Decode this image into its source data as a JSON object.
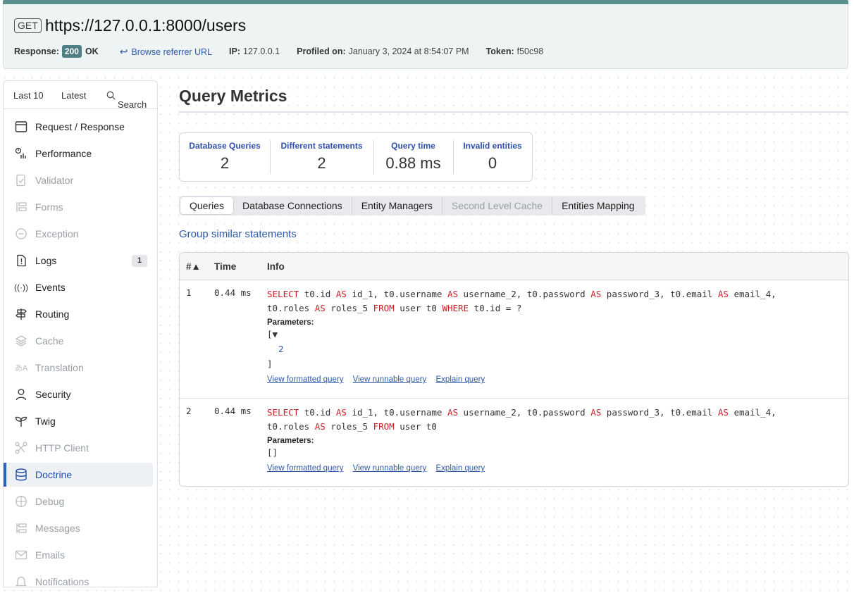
{
  "header": {
    "method": "GET",
    "url": "https://127.0.0.1:8000/users",
    "response_label": "Response:",
    "status_code": "200",
    "status_text": "OK",
    "referrer_link": "Browse referrer URL",
    "ip_label": "IP:",
    "ip_value": "127.0.0.1",
    "profiled_label": "Profiled on:",
    "profiled_value": "January 3, 2024 at 8:54:07 PM",
    "token_label": "Token:",
    "token_value": "f50c98"
  },
  "sidebar": {
    "tabs": [
      "Last 10",
      "Latest",
      "Search"
    ],
    "items": [
      {
        "label": "Request / Response",
        "icon": "request-response-icon",
        "state": "enabled"
      },
      {
        "label": "Performance",
        "icon": "performance-icon",
        "state": "enabled"
      },
      {
        "label": "Validator",
        "icon": "validator-icon",
        "state": "disabled"
      },
      {
        "label": "Forms",
        "icon": "forms-icon",
        "state": "disabled"
      },
      {
        "label": "Exception",
        "icon": "exception-icon",
        "state": "disabled"
      },
      {
        "label": "Logs",
        "icon": "logs-icon",
        "state": "enabled",
        "count": "1"
      },
      {
        "label": "Events",
        "icon": "events-icon",
        "state": "enabled"
      },
      {
        "label": "Routing",
        "icon": "routing-icon",
        "state": "enabled"
      },
      {
        "label": "Cache",
        "icon": "cache-icon",
        "state": "disabled"
      },
      {
        "label": "Translation",
        "icon": "translation-icon",
        "state": "disabled"
      },
      {
        "label": "Security",
        "icon": "security-icon",
        "state": "enabled"
      },
      {
        "label": "Twig",
        "icon": "twig-icon",
        "state": "enabled"
      },
      {
        "label": "HTTP Client",
        "icon": "http-client-icon",
        "state": "disabled"
      },
      {
        "label": "Doctrine",
        "icon": "database-icon",
        "state": "active"
      },
      {
        "label": "Debug",
        "icon": "debug-icon",
        "state": "disabled"
      },
      {
        "label": "Messages",
        "icon": "messages-icon",
        "state": "disabled"
      },
      {
        "label": "Emails",
        "icon": "emails-icon",
        "state": "disabled"
      },
      {
        "label": "Notifications",
        "icon": "notifications-icon",
        "state": "disabled"
      }
    ]
  },
  "main": {
    "title": "Query Metrics",
    "metrics": [
      {
        "label": "Database Queries",
        "value": "2"
      },
      {
        "label": "Different statements",
        "value": "2"
      },
      {
        "label": "Query time",
        "value": "0.88 ms"
      },
      {
        "label": "Invalid entities",
        "value": "0"
      }
    ],
    "tabs": [
      {
        "label": "Queries",
        "state": "active"
      },
      {
        "label": "Database Connections",
        "state": "enabled"
      },
      {
        "label": "Entity Managers",
        "state": "enabled"
      },
      {
        "label": "Second Level Cache",
        "state": "disabled"
      },
      {
        "label": "Entities Mapping",
        "state": "enabled"
      }
    ],
    "group_link": "Group similar statements",
    "table": {
      "columns": [
        "#▲",
        "Time",
        "Info"
      ],
      "parameters_label": "Parameters:",
      "links": [
        "View formatted query",
        "View runnable query",
        "Explain query"
      ],
      "rows": [
        {
          "num": "1",
          "time": "0.44 ms",
          "sql_line1": "SELECT t0.id AS id_1, t0.username AS username_2, t0.password AS password_3, t0.email AS email_4,",
          "sql_line2": "t0.roles AS roles_5 FROM user t0 WHERE t0.id = ?",
          "params_open": "[▼",
          "params_value": "2",
          "params_close": "]"
        },
        {
          "num": "2",
          "time": "0.44 ms",
          "sql_line1": "SELECT t0.id AS id_1, t0.username AS username_2, t0.password AS password_3, t0.email AS email_4,",
          "sql_line2": "t0.roles AS roles_5 FROM user t0",
          "params_empty": "[]"
        }
      ]
    }
  },
  "colors": {
    "accent_bar": "#5b8f8f",
    "status_badge": "#4f7f84",
    "link": "#2f5aa8",
    "active_nav": "#2f5ec4",
    "sql_keyword": "#c8222a"
  }
}
